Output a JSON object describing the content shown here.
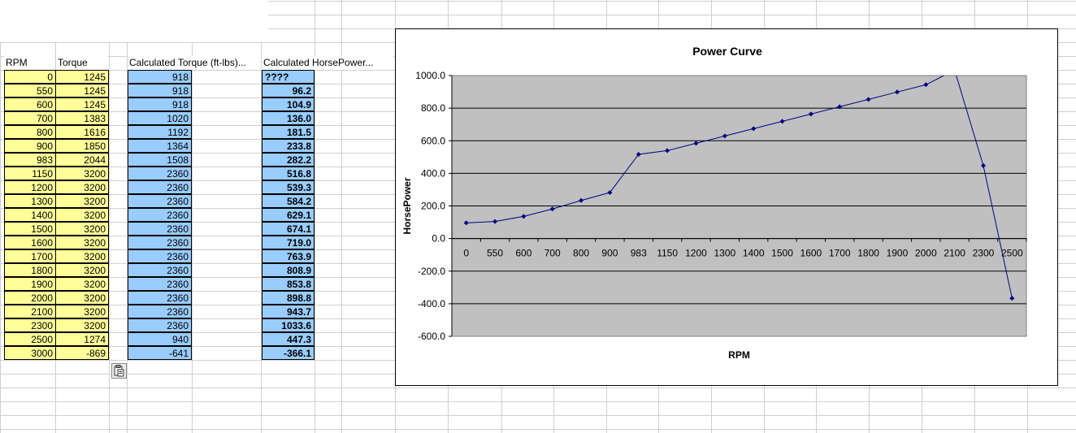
{
  "table": {
    "headers": {
      "rpm": "RPM",
      "torque": "Torque",
      "calc_torque": "Calculated Torque (ft-lbs)...",
      "calc_hp": "Calculated HorsePower..."
    },
    "rows": [
      {
        "rpm": "0",
        "torque": "1245",
        "calc_torque": "918",
        "calc_hp": "????"
      },
      {
        "rpm": "550",
        "torque": "1245",
        "calc_torque": "918",
        "calc_hp": "96.2"
      },
      {
        "rpm": "600",
        "torque": "1245",
        "calc_torque": "918",
        "calc_hp": "104.9"
      },
      {
        "rpm": "700",
        "torque": "1383",
        "calc_torque": "1020",
        "calc_hp": "136.0"
      },
      {
        "rpm": "800",
        "torque": "1616",
        "calc_torque": "1192",
        "calc_hp": "181.5"
      },
      {
        "rpm": "900",
        "torque": "1850",
        "calc_torque": "1364",
        "calc_hp": "233.8"
      },
      {
        "rpm": "983",
        "torque": "2044",
        "calc_torque": "1508",
        "calc_hp": "282.2"
      },
      {
        "rpm": "1150",
        "torque": "3200",
        "calc_torque": "2360",
        "calc_hp": "516.8"
      },
      {
        "rpm": "1200",
        "torque": "3200",
        "calc_torque": "2360",
        "calc_hp": "539.3"
      },
      {
        "rpm": "1300",
        "torque": "3200",
        "calc_torque": "2360",
        "calc_hp": "584.2"
      },
      {
        "rpm": "1400",
        "torque": "3200",
        "calc_torque": "2360",
        "calc_hp": "629.1"
      },
      {
        "rpm": "1500",
        "torque": "3200",
        "calc_torque": "2360",
        "calc_hp": "674.1"
      },
      {
        "rpm": "1600",
        "torque": "3200",
        "calc_torque": "2360",
        "calc_hp": "719.0"
      },
      {
        "rpm": "1700",
        "torque": "3200",
        "calc_torque": "2360",
        "calc_hp": "763.9"
      },
      {
        "rpm": "1800",
        "torque": "3200",
        "calc_torque": "2360",
        "calc_hp": "808.9"
      },
      {
        "rpm": "1900",
        "torque": "3200",
        "calc_torque": "2360",
        "calc_hp": "853.8"
      },
      {
        "rpm": "2000",
        "torque": "3200",
        "calc_torque": "2360",
        "calc_hp": "898.8"
      },
      {
        "rpm": "2100",
        "torque": "3200",
        "calc_torque": "2360",
        "calc_hp": "943.7"
      },
      {
        "rpm": "2300",
        "torque": "3200",
        "calc_torque": "2360",
        "calc_hp": "1033.6"
      },
      {
        "rpm": "2500",
        "torque": "1274",
        "calc_torque": "940",
        "calc_hp": "447.3"
      },
      {
        "rpm": "3000",
        "torque": "-869",
        "calc_torque": "-641",
        "calc_hp": "-366.1"
      }
    ]
  },
  "paste_options_icon": "clipboard-paste-icon",
  "chart_data": {
    "type": "line",
    "title": "Power Curve",
    "xlabel": "RPM",
    "ylabel": "HorsePower",
    "categories": [
      "0",
      "550",
      "600",
      "700",
      "800",
      "900",
      "983",
      "1150",
      "1200",
      "1300",
      "1400",
      "1500",
      "1600",
      "1700",
      "1800",
      "1900",
      "2000",
      "2100",
      "2300",
      "2500"
    ],
    "values": [
      96.2,
      104.9,
      136.0,
      181.5,
      233.8,
      282.2,
      516.8,
      539.3,
      584.2,
      629.1,
      674.1,
      719.0,
      763.9,
      808.9,
      853.8,
      898.8,
      943.7,
      1033.6,
      447.3,
      -366.1
    ],
    "ylim": [
      -600,
      1000
    ],
    "ytick_step": 200,
    "ytick_labels": [
      "1000.0",
      "800.0",
      "600.0",
      "400.0",
      "200.0",
      "0.0",
      "-200.0",
      "-400.0",
      "-600.0"
    ],
    "grid": true,
    "legend": "none",
    "colors": {
      "plot_background": "#c0c0c0",
      "series": "#000080",
      "gridline": "#000000"
    }
  },
  "colors": {
    "yellow_fill": "#ffff99",
    "blue_fill": "#99ccff",
    "grid_lines": "#c0c0c0"
  }
}
